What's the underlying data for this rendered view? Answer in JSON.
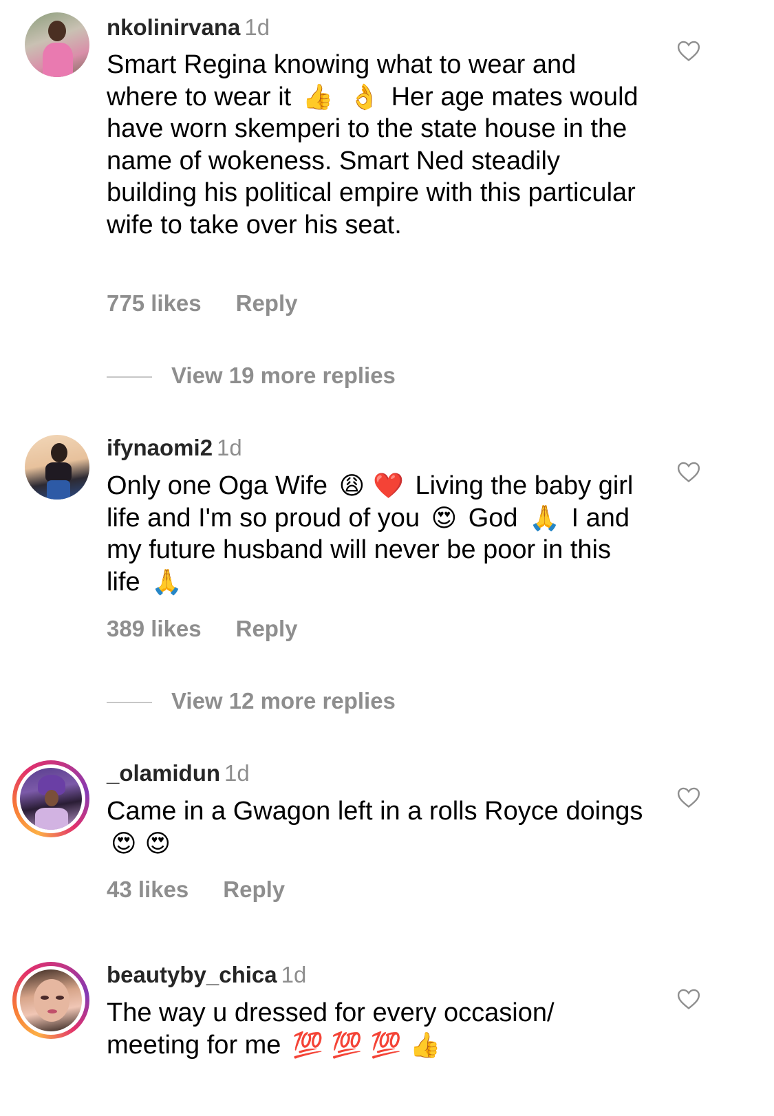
{
  "comments": [
    {
      "username": "nkolinirvana",
      "time": "1d",
      "text_parts": [
        "Smart Regina knowing what to wear and where to wear it ",
        "👍",
        " ",
        "👌",
        " Her age mates would have worn skemperi to the state house in the name of wokeness. Smart Ned steadily building his political empire with this particular wife to take over his seat."
      ],
      "likes": "775 likes",
      "reply_label": "Reply",
      "view_replies": "View 19 more replies",
      "avatar_story_ring": false,
      "like_icon": "heart-outline-icon"
    },
    {
      "username": "ifynaomi2",
      "time": "1d",
      "text_parts": [
        "Only one Oga Wife ",
        "😩",
        "❤️",
        " Living the baby girl life and I'm so proud of you ",
        "😍",
        " God ",
        "🙏",
        " I and my future husband will never be poor in this life ",
        "🙏"
      ],
      "likes": "389 likes",
      "reply_label": "Reply",
      "view_replies": "View 12 more replies",
      "avatar_story_ring": false,
      "like_icon": "heart-outline-icon"
    },
    {
      "username": "_olamidun",
      "time": "1d",
      "text_parts": [
        "Came in a Gwagon left in a rolls Royce doings ",
        "😍",
        "😍"
      ],
      "likes": "43 likes",
      "reply_label": "Reply",
      "avatar_story_ring": true,
      "like_icon": "heart-outline-icon"
    },
    {
      "username": "beautyby_chica",
      "time": "1d",
      "text_parts": [
        "The way u dressed for every occasion/ meeting for me ",
        "💯",
        "💯",
        "💯",
        "👍"
      ],
      "avatar_story_ring": true,
      "like_icon": "heart-outline-icon"
    }
  ],
  "colors": {
    "secondary_text": "#8e8e8e",
    "username": "#262626",
    "story_ring": [
      "#fcaf45",
      "#f77737",
      "#e1306c",
      "#c13584",
      "#833ab4"
    ]
  }
}
